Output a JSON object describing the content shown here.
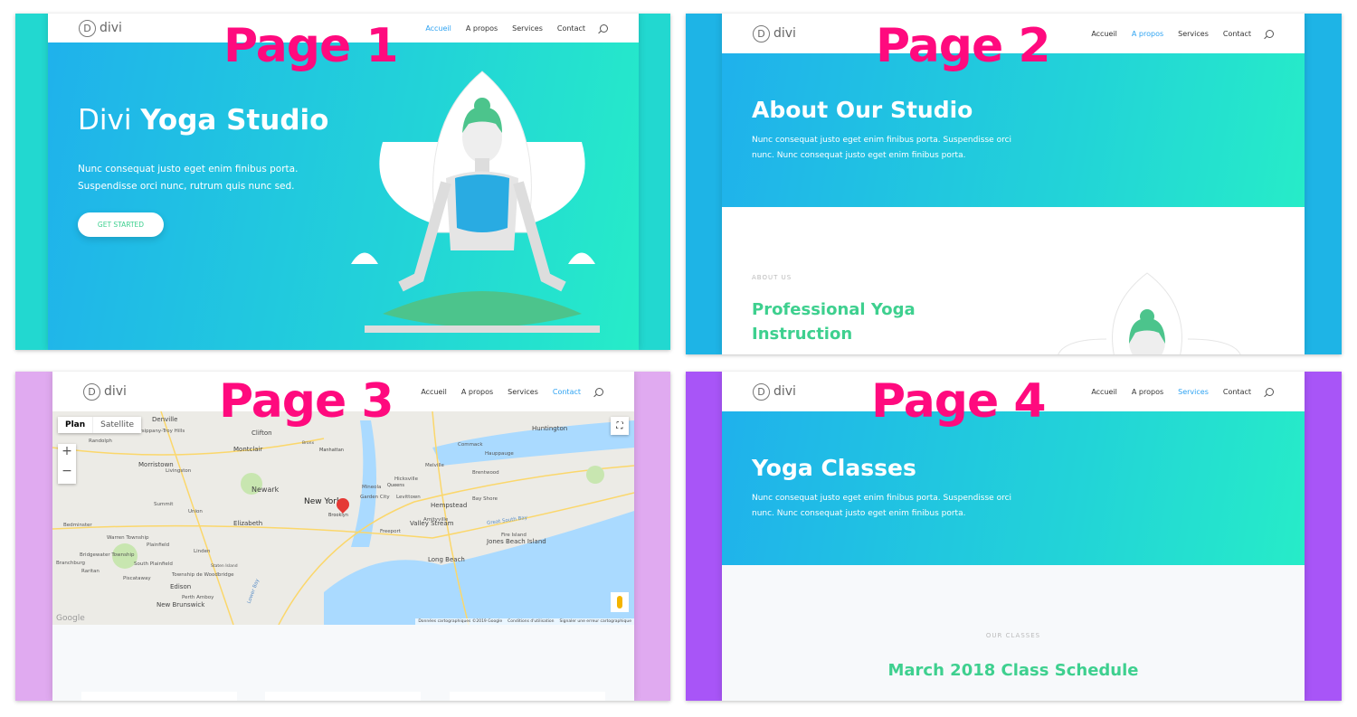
{
  "nav": {
    "logo": "divi",
    "logo_mark": "D",
    "items": [
      "Accueil",
      "A propos",
      "Services",
      "Contact"
    ]
  },
  "colors": {
    "overlay_label": "#ff0a7e",
    "accent_green": "#3ed08f",
    "nav_active": "#2ea3f2",
    "page2_bg": "#1eb4e6",
    "page3_bg": "#e0aaf0",
    "page4_bg": "#a855f7"
  },
  "page1": {
    "label": "Page 1",
    "active_nav": "Accueil",
    "title_light": "Divi",
    "title_bold": "Yoga Studio",
    "body_line1": "Nunc consequat justo eget enim finibus porta.",
    "body_line2": "Suspendisse orci nunc, rutrum quis nunc sed.",
    "cta": "GET STARTED"
  },
  "page2": {
    "label": "Page 2",
    "active_nav": "A propos",
    "title": "About Our Studio",
    "body_line1": "Nunc consequat justo eget enim finibus porta. Suspendisse orci",
    "body_line2": "nunc. Nunc consequat justo eget enim finibus porta.",
    "eyebrow": "ABOUT US",
    "heading_line1": "Professional Yoga",
    "heading_line2": "Instruction"
  },
  "page3": {
    "label": "Page 3",
    "active_nav": "Contact",
    "map": {
      "tab_plan": "Plan",
      "tab_satellite": "Satellite",
      "zoom_in": "+",
      "zoom_out": "−",
      "google": "Google",
      "attribution": [
        "Données cartographiques ©2019 Google",
        "Conditions d'utilisation",
        "Signaler une erreur cartographique"
      ],
      "places": [
        "Denville",
        "Parsippany-Troy Hills",
        "Randolph",
        "Clifton",
        "Montclair",
        "Morristown",
        "Livingston",
        "Newark",
        "Manhattan",
        "Bronx",
        "Queens",
        "New York",
        "Brooklyn",
        "Summit",
        "Union",
        "Elizabeth",
        "Bedminster",
        "Warren Township",
        "Plainfield",
        "Linden",
        "Bridgewater Township",
        "Branchburg",
        "Raritan",
        "South Plainfield",
        "Piscataway",
        "Staten Island",
        "Township de Woodbridge",
        "Edison",
        "Perth Amboy",
        "New Brunswick",
        "Huntington",
        "Commack",
        "Hauppauge",
        "Melville",
        "Brentwood",
        "Hicksville",
        "Mineola",
        "Garden City",
        "Levittown",
        "Hempstead",
        "Bay Shore",
        "Valley Stream",
        "Freeport",
        "Amityville",
        "Long Beach",
        "Jones Beach Island",
        "Great South Bay",
        "Fire Island",
        "Lower Bay"
      ]
    }
  },
  "page4": {
    "label": "Page 4",
    "active_nav": "Services",
    "title": "Yoga Classes",
    "body_line1": "Nunc consequat justo eget enim finibus porta. Suspendisse orci",
    "body_line2": "nunc. Nunc consequat justo eget enim finibus porta.",
    "eyebrow": "OUR CLASSES",
    "heading": "March 2018 Class Schedule"
  }
}
